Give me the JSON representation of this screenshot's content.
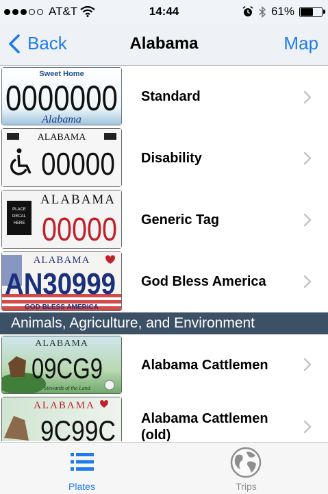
{
  "status_bar": {
    "carrier": "AT&T",
    "time": "14:44",
    "battery": "61%",
    "battery_level": 0.61,
    "signal_bars_filled": 3,
    "signal_bars_total": 5
  },
  "nav": {
    "back_label": "Back",
    "title": "Alabama",
    "map_label": "Map"
  },
  "plates": [
    {
      "label": "Standard",
      "plate_number": "0000000",
      "plate_top": "Sweet Home",
      "plate_bottom": "Alabama"
    },
    {
      "label": "Disability",
      "plate_number": "00000",
      "plate_top": "ALABAMA"
    },
    {
      "label": "Generic Tag",
      "plate_number": "00000",
      "plate_top": "ALABAMA",
      "decal_line1": "PLACE",
      "decal_line2": "DECAL",
      "decal_line3": "HERE"
    },
    {
      "label": "God Bless America",
      "plate_number": "AN30999",
      "plate_top": "ALABAMA",
      "plate_bottom": "GOD BLESS AMERICA"
    }
  ],
  "section_header": "Animals, Agriculture, and Environment",
  "animal_plates": [
    {
      "label": "Alabama Cattlemen",
      "plate_number": "09CG9",
      "plate_top": "ALABAMA",
      "plate_bottom": "Stewards of the Land"
    },
    {
      "label_line1": "Alabama Cattlemen",
      "label_line2": "(old)",
      "plate_number": "9C99C",
      "plate_top": "ALABAMA"
    }
  ],
  "tabs": {
    "plates_label": "Plates",
    "trips_label": "Trips"
  },
  "colors": {
    "ios_blue": "#1e7bea",
    "section_bg": "#3d5166",
    "plate_red": "#c0202a",
    "plate_navy": "#1c2f7a"
  }
}
